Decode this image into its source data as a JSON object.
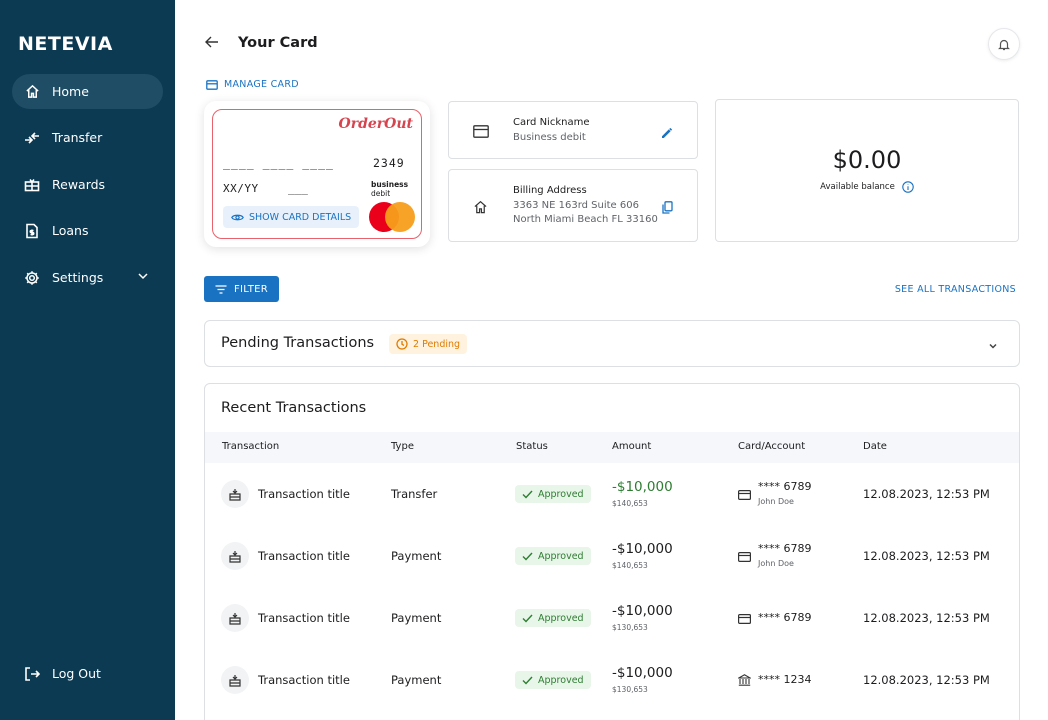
{
  "sidebar": {
    "logo": "NETEVIA",
    "items": [
      {
        "label": "Home",
        "icon": "home-icon"
      },
      {
        "label": "Transfer",
        "icon": "transfer-icon"
      },
      {
        "label": "Rewards",
        "icon": "gift-icon"
      },
      {
        "label": "Loans",
        "icon": "document-dollar-icon"
      },
      {
        "label": "Settings",
        "icon": "gear-icon"
      }
    ],
    "logout": "Log Out"
  },
  "header": {
    "title": "Your Card"
  },
  "manage_card": "MANAGE CARD",
  "card": {
    "brand": "OrderOut",
    "masked_number": "____ ____ ____",
    "last4": "2349",
    "expiry": "XX/YY",
    "cvv": "___",
    "type_line1": "business",
    "type_line2": "debit",
    "show_details": "SHOW CARD DETAILS"
  },
  "nickname": {
    "title": "Card Nickname",
    "value": "Business debit"
  },
  "billing": {
    "title": "Billing Address",
    "line1": "3363 NE 163rd Suite 606",
    "line2": "North Miami Beach FL 33160"
  },
  "balance": {
    "amount": "$0.00",
    "label": "Available balance"
  },
  "filter": "FILTER",
  "see_all": "SEE ALL TRANSACTIONS",
  "pending": {
    "title": "Pending Transactions",
    "badge": "2 Pending"
  },
  "recent": {
    "title": "Recent Transactions",
    "columns": [
      "Transaction",
      "Type",
      "Status",
      "Amount",
      "Card/Account",
      "Date"
    ],
    "rows": [
      {
        "title": "Transaction title",
        "type": "Transfer",
        "status": "Approved",
        "amount": "-$10,000",
        "sub": "$140,653",
        "card": "**** 6789",
        "holder": "John Doe",
        "date": "12.08.2023, 12:53 PM"
      },
      {
        "title": "Transaction title",
        "type": "Payment",
        "status": "Approved",
        "amount": "-$10,000",
        "sub": "$140,653",
        "card": "**** 6789",
        "holder": "John Doe",
        "date": "12.08.2023, 12:53 PM"
      },
      {
        "title": "Transaction title",
        "type": "Payment",
        "status": "Approved",
        "amount": "-$10,000",
        "sub": "$130,653",
        "card": "**** 6789",
        "holder": "",
        "date": "12.08.2023, 12:53 PM"
      },
      {
        "title": "Transaction title",
        "type": "Payment",
        "status": "Approved",
        "amount": "-$10,000",
        "sub": "$130,653",
        "card": "**** 1234",
        "holder": "",
        "date": "12.08.2023, 12:53 PM"
      }
    ]
  },
  "colors": {
    "sidebar": "#0c3a52",
    "accent": "#1a73c2",
    "approved": "#2e7d32",
    "pending": "#e07b00"
  }
}
